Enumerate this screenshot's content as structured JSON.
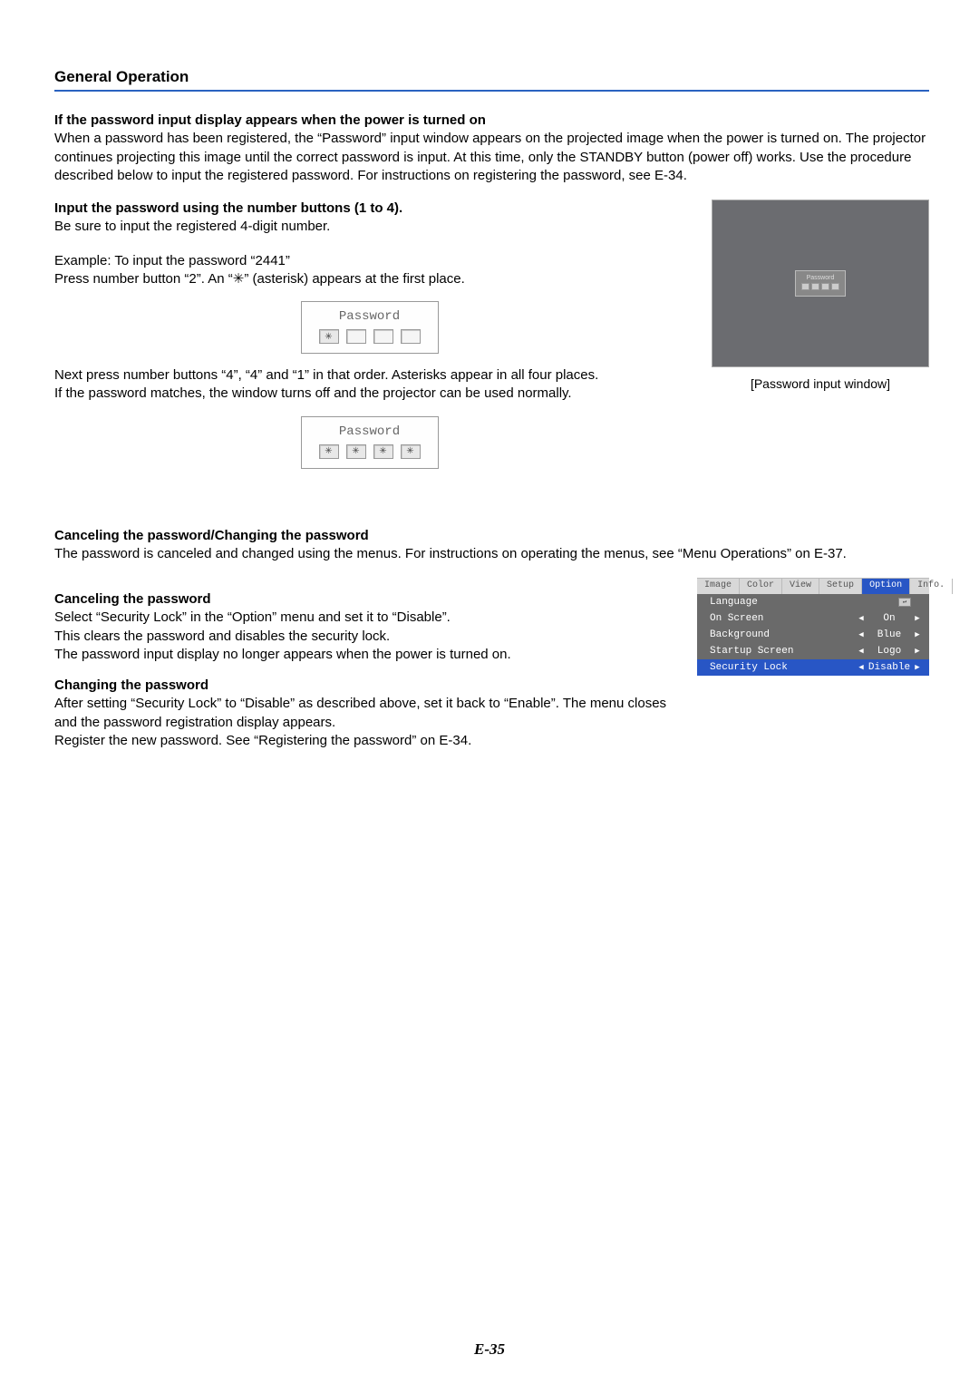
{
  "header": {
    "title": "General Operation"
  },
  "s1": {
    "h": "If the password input display appears when the power is turned on",
    "p": "When a password has been registered, the “Password” input window appears on the projected image when the power is turned on. The projector continues projecting this image until the correct password is input. At this time, only the STANDBY button (power off) works. Use the procedure described below to input the registered password. For instructions on registering the password, see E-34."
  },
  "s2": {
    "h": "Input the password using the number buttons (1 to 4).",
    "p1": "Be sure to input the registered 4-digit number.",
    "ex1": "Example: To input the password “2441”",
    "ex2": "Press number button “2”. An “✳” (asterisk) appears at the first place.",
    "dialogTitle": "Password",
    "p2a": "Next press number buttons “4”, “4” and “1” in that order. Asterisks appear in all four places.",
    "p2b": "If the password matches, the window turns off and the projector can be used normally.",
    "caption": "[Password input window]"
  },
  "s3": {
    "h": "Canceling the password/Changing the password",
    "p": "The password is canceled and changed using the menus. For instructions on operating the menus, see “Menu Operations” on E-37."
  },
  "s4": {
    "h": "Canceling the password",
    "l1": "Select “Security Lock” in the “Option” menu and set it to “Disable”.",
    "l2": "This clears the password and disables the security lock.",
    "l3": "The password input display no longer appears when the power is turned on."
  },
  "s5": {
    "h": "Changing the password",
    "l1": "After setting “Security Lock” to “Disable” as described above, set it back to “Enable”. The menu closes and the password registration display appears.",
    "l2": "Register the new password. See “Registering the password” on E-34."
  },
  "menu": {
    "tabs": [
      "Image",
      "Color",
      "View",
      "Setup",
      "Option",
      "Info."
    ],
    "activeTab": "Option",
    "rows": [
      {
        "label": "Language",
        "value": "",
        "type": "enter"
      },
      {
        "label": "On Screen",
        "value": "On",
        "type": "lr"
      },
      {
        "label": "Background",
        "value": "Blue",
        "type": "lr"
      },
      {
        "label": "Startup Screen",
        "value": "Logo",
        "type": "lr"
      },
      {
        "label": "Security Lock",
        "value": "Disable",
        "type": "lr",
        "sel": true
      }
    ]
  },
  "page": "E-35",
  "ast": "✳"
}
